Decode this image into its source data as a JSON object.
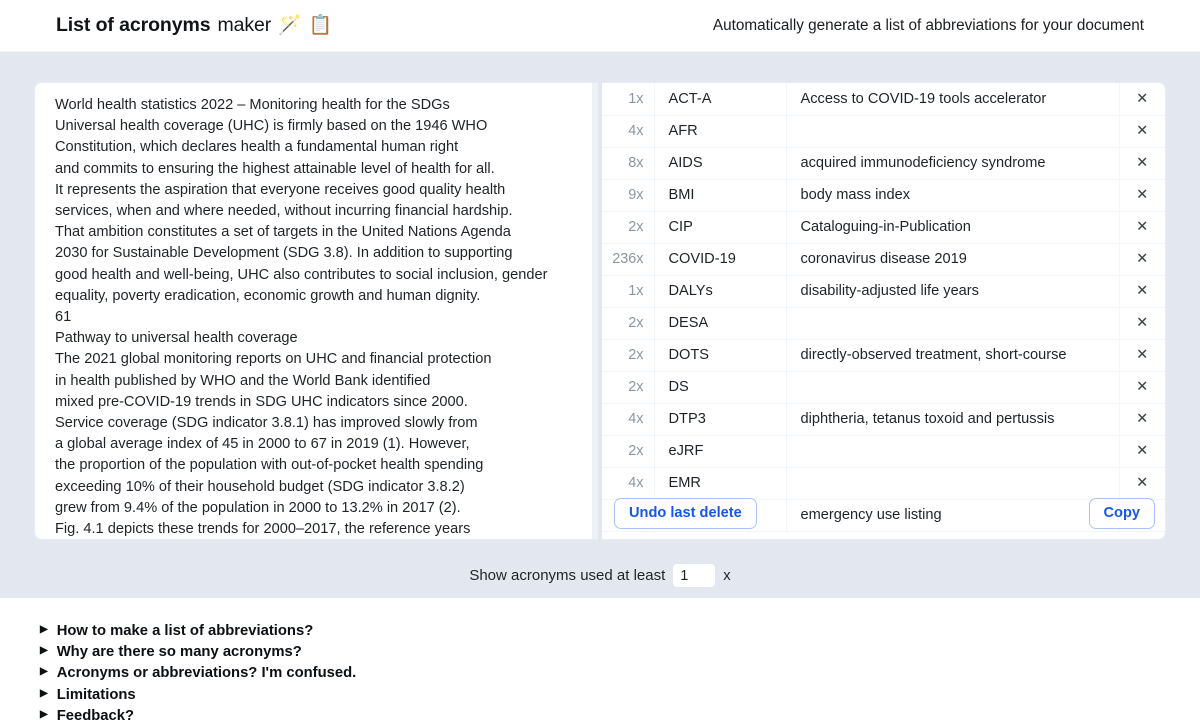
{
  "header": {
    "brand_strong": "List of acronyms",
    "brand_light": "maker",
    "wand_emoji": "🪄",
    "clipboard_emoji": "📋",
    "tagline": "Automatically generate a list of abbreviations for your document"
  },
  "document": {
    "text": "World health statistics 2022 – Monitoring health for the SDGs\nUniversal health coverage (UHC) is firmly based on the 1946 WHO\nConstitution, which declares health a fundamental human right\nand commits to ensuring the highest attainable level of health for all.\nIt represents the aspiration that everyone receives good quality health\nservices, when and where needed, without incurring financial hardship.\nThat ambition constitutes a set of targets in the United Nations Agenda\n2030 for Sustainable Development (SDG 3.8). In addition to supporting\ngood health and well-being, UHC also contributes to social inclusion, gender\nequality, poverty eradication, economic growth and human dignity.\n61\nPathway to universal health coverage\nThe 2021 global monitoring reports on UHC and financial protection\nin health published by WHO and the World Bank identified\nmixed pre-COVID-19 trends in SDG UHC indicators since 2000.\nService coverage (SDG indicator 3.8.1) has improved slowly from\na global average index of 45 in 2000 to 67 in 2019 (1). However,\nthe proportion of the population with out-of-pocket health spending\nexceeding 10% of their household budget (SDG indicator 3.8.2)\ngrew from 9.4% of the population in 2000 to 13.2% in 2017 (2).\nFig. 4.1 depicts these trends for 2000–2017, the reference years\nfor which regional values are available for both indicators."
  },
  "acronyms": {
    "delete_icon": "✕",
    "rows": [
      {
        "count": "1x",
        "abbr": "ACT-A",
        "definition": "Access to COVID-19 tools accelerator"
      },
      {
        "count": "4x",
        "abbr": "AFR",
        "definition": ""
      },
      {
        "count": "8x",
        "abbr": "AIDS",
        "definition": "acquired immunodeficiency syndrome"
      },
      {
        "count": "9x",
        "abbr": "BMI",
        "definition": "body mass index"
      },
      {
        "count": "2x",
        "abbr": "CIP",
        "definition": "Cataloguing-in-Publication"
      },
      {
        "count": "236x",
        "abbr": "COVID-19",
        "definition": "coronavirus disease 2019"
      },
      {
        "count": "1x",
        "abbr": "DALYs",
        "definition": "disability-adjusted life years"
      },
      {
        "count": "2x",
        "abbr": "DESA",
        "definition": ""
      },
      {
        "count": "2x",
        "abbr": "DOTS",
        "definition": "directly-observed treatment, short-course"
      },
      {
        "count": "2x",
        "abbr": "DS",
        "definition": ""
      },
      {
        "count": "4x",
        "abbr": "DTP3",
        "definition": "diphtheria, tetanus toxoid and pertussis"
      },
      {
        "count": "2x",
        "abbr": "eJRF",
        "definition": ""
      },
      {
        "count": "4x",
        "abbr": "EMR",
        "definition": ""
      },
      {
        "count": "",
        "abbr": "",
        "definition": "emergency use listing"
      }
    ]
  },
  "actions": {
    "undo_label": "Undo last delete",
    "copy_label": "Copy"
  },
  "filter": {
    "label": "Show acronyms used at least",
    "value": "1",
    "unit": "x"
  },
  "faq": {
    "marker": "▶",
    "items": [
      {
        "label": "How to make a list of abbreviations?"
      },
      {
        "label": "Why are there so many acronyms?"
      },
      {
        "label": "Acronyms or abbreviations? I'm confused."
      },
      {
        "label": "Limitations"
      },
      {
        "label": "Feedback?"
      }
    ]
  },
  "colors": {
    "background": "#e3e8f0",
    "accent": "#1558e8",
    "panel": "#ffffff",
    "muted_text": "#8c95a1"
  }
}
